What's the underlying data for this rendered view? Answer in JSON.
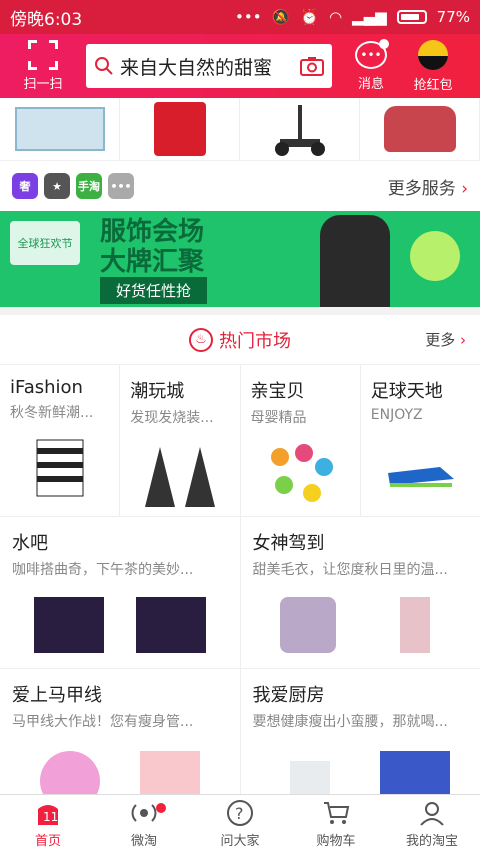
{
  "status": {
    "time": "傍晚6:03",
    "battery": "77%"
  },
  "header": {
    "scan_label": "扫一扫",
    "search_text": "来自大自然的甜蜜",
    "message_label": "消息",
    "redpack_label": "抢红包"
  },
  "services": {
    "more_label": "更多服务",
    "icons": [
      {
        "name": "service-icon-1",
        "color": "#7b3fe4",
        "glyph": "奢"
      },
      {
        "name": "service-icon-2",
        "color": "#555555",
        "glyph": "★"
      },
      {
        "name": "service-icon-3",
        "color": "#3cb043",
        "glyph": "手淘"
      },
      {
        "name": "service-icon-4",
        "color": "#aaaaaa",
        "glyph": "•••"
      }
    ]
  },
  "banner": {
    "line1": "服饰会场",
    "line2": "大牌汇聚",
    "pill": "好货任性抢",
    "badge": "全球狂欢节"
  },
  "hot": {
    "title": "热门市场",
    "more": "更多"
  },
  "markets4": [
    {
      "title": "iFashion",
      "sub": "秋冬新鲜潮..."
    },
    {
      "title": "潮玩城",
      "sub": "发现发烧装..."
    },
    {
      "title": "亲宝贝",
      "sub": "母婴精品"
    },
    {
      "title": "足球天地",
      "sub": "ENJOYZ"
    }
  ],
  "markets2a": [
    {
      "title": "水吧",
      "sub": "咖啡搭曲奇，下午茶的美妙..."
    },
    {
      "title": "女神驾到",
      "sub": "甜美毛衣，让您度秋日里的温..."
    }
  ],
  "markets2b": [
    {
      "title": "爱上马甲线",
      "sub": "马甲线大作战！您有瘦身管..."
    },
    {
      "title": "我爱厨房",
      "sub": "要想健康瘦出小蛮腰，那就喝..."
    }
  ],
  "tabs": [
    {
      "label": "首页",
      "icon": "home-icon"
    },
    {
      "label": "微淘",
      "icon": "broadcast-icon"
    },
    {
      "label": "问大家",
      "icon": "question-icon"
    },
    {
      "label": "购物车",
      "icon": "cart-icon"
    },
    {
      "label": "我的淘宝",
      "icon": "profile-icon"
    }
  ],
  "colors": {
    "brand": "#f0203e",
    "statusbar": "#d81e3c"
  }
}
